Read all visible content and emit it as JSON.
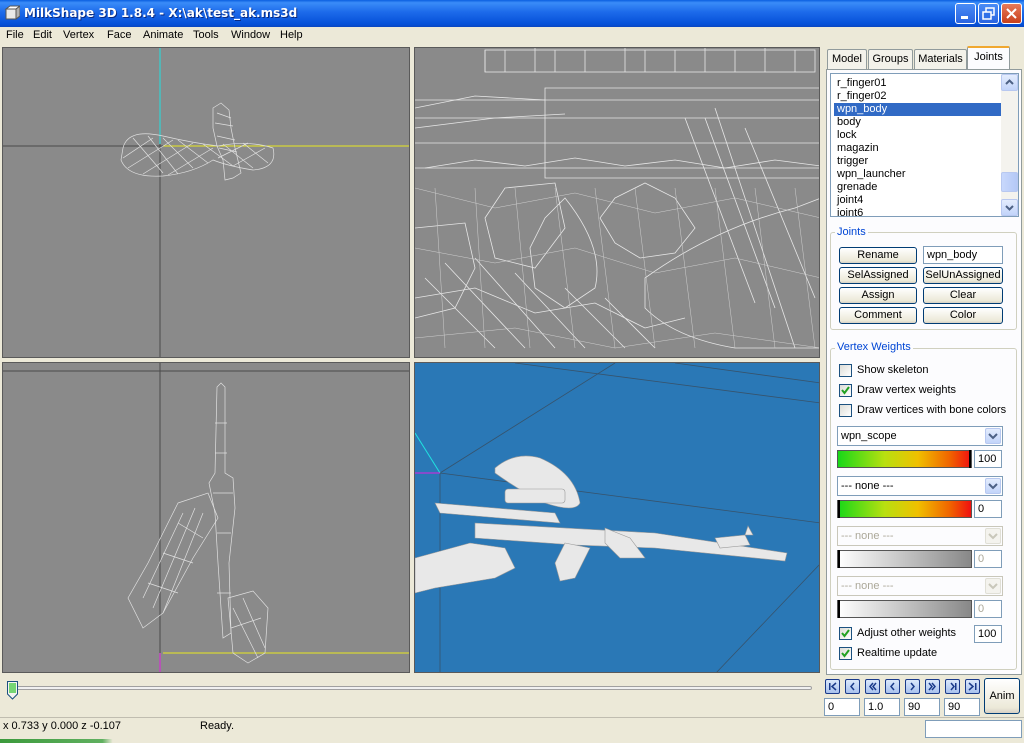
{
  "window": {
    "title": "MilkShape 3D 1.8.4 - X:\\ak\\test_ak.ms3d"
  },
  "menu": [
    "File",
    "Edit",
    "Vertex",
    "Face",
    "Animate",
    "Tools",
    "Window",
    "Help"
  ],
  "tabs": [
    "Model",
    "Groups",
    "Materials",
    "Joints"
  ],
  "active_tab": "Joints",
  "joints_list": {
    "items": [
      "r_finger01",
      "r_finger02",
      "wpn_body",
      "body",
      "lock",
      "magazin",
      "trigger",
      "wpn_launcher",
      "grenade",
      "joint4",
      "joint6"
    ],
    "selected": "wpn_body"
  },
  "joints_group": {
    "label": "Joints",
    "rename_button": "Rename",
    "name_value": "wpn_body",
    "sel_assigned_button": "SelAssigned",
    "sel_unassigned_button": "SelUnAssigned",
    "assign_button": "Assign",
    "clear_button": "Clear",
    "comment_button": "Comment",
    "color_button": "Color"
  },
  "vertex_weights": {
    "label": "Vertex Weights",
    "show_skeleton": {
      "label": "Show skeleton",
      "checked": false
    },
    "draw_vertex_weights": {
      "label": "Draw vertex weights",
      "checked": true
    },
    "draw_bone_colors": {
      "label": "Draw vertices with bone colors",
      "checked": false
    },
    "bone1": {
      "value": "wpn_scope",
      "weight": "100"
    },
    "bone2": {
      "value": "--- none ---",
      "weight": "0"
    },
    "bone3": {
      "value": "--- none ---",
      "weight": "0"
    },
    "bone4": {
      "value": "--- none ---",
      "weight": "0"
    },
    "adjust_other": {
      "label": "Adjust other weights",
      "checked": true,
      "value": "100"
    },
    "realtime_update": {
      "label": "Realtime update",
      "checked": true
    }
  },
  "timeline": {
    "frame": "0",
    "speed": "1.0",
    "end_frame": "90",
    "total_frames": "90",
    "anim_button": "Anim",
    "position": 0.0
  },
  "status": {
    "coords": "x 0.733 y 0.000 z -0.107",
    "message": "Ready."
  },
  "colors": {
    "viewport_bg": "#8a8a8a",
    "viewport_3d_bg": "#2a78b6",
    "wire": "#d8d8d8",
    "axis_cyan": "#20e0e0",
    "axis_yellow": "#e8e820",
    "axis_magenta": "#e020e0",
    "selection": "#316ac5"
  },
  "icons": {
    "app": "milkshape-icon",
    "minimize": "minimize-icon",
    "maximize": "restore-icon",
    "close": "close-icon"
  }
}
